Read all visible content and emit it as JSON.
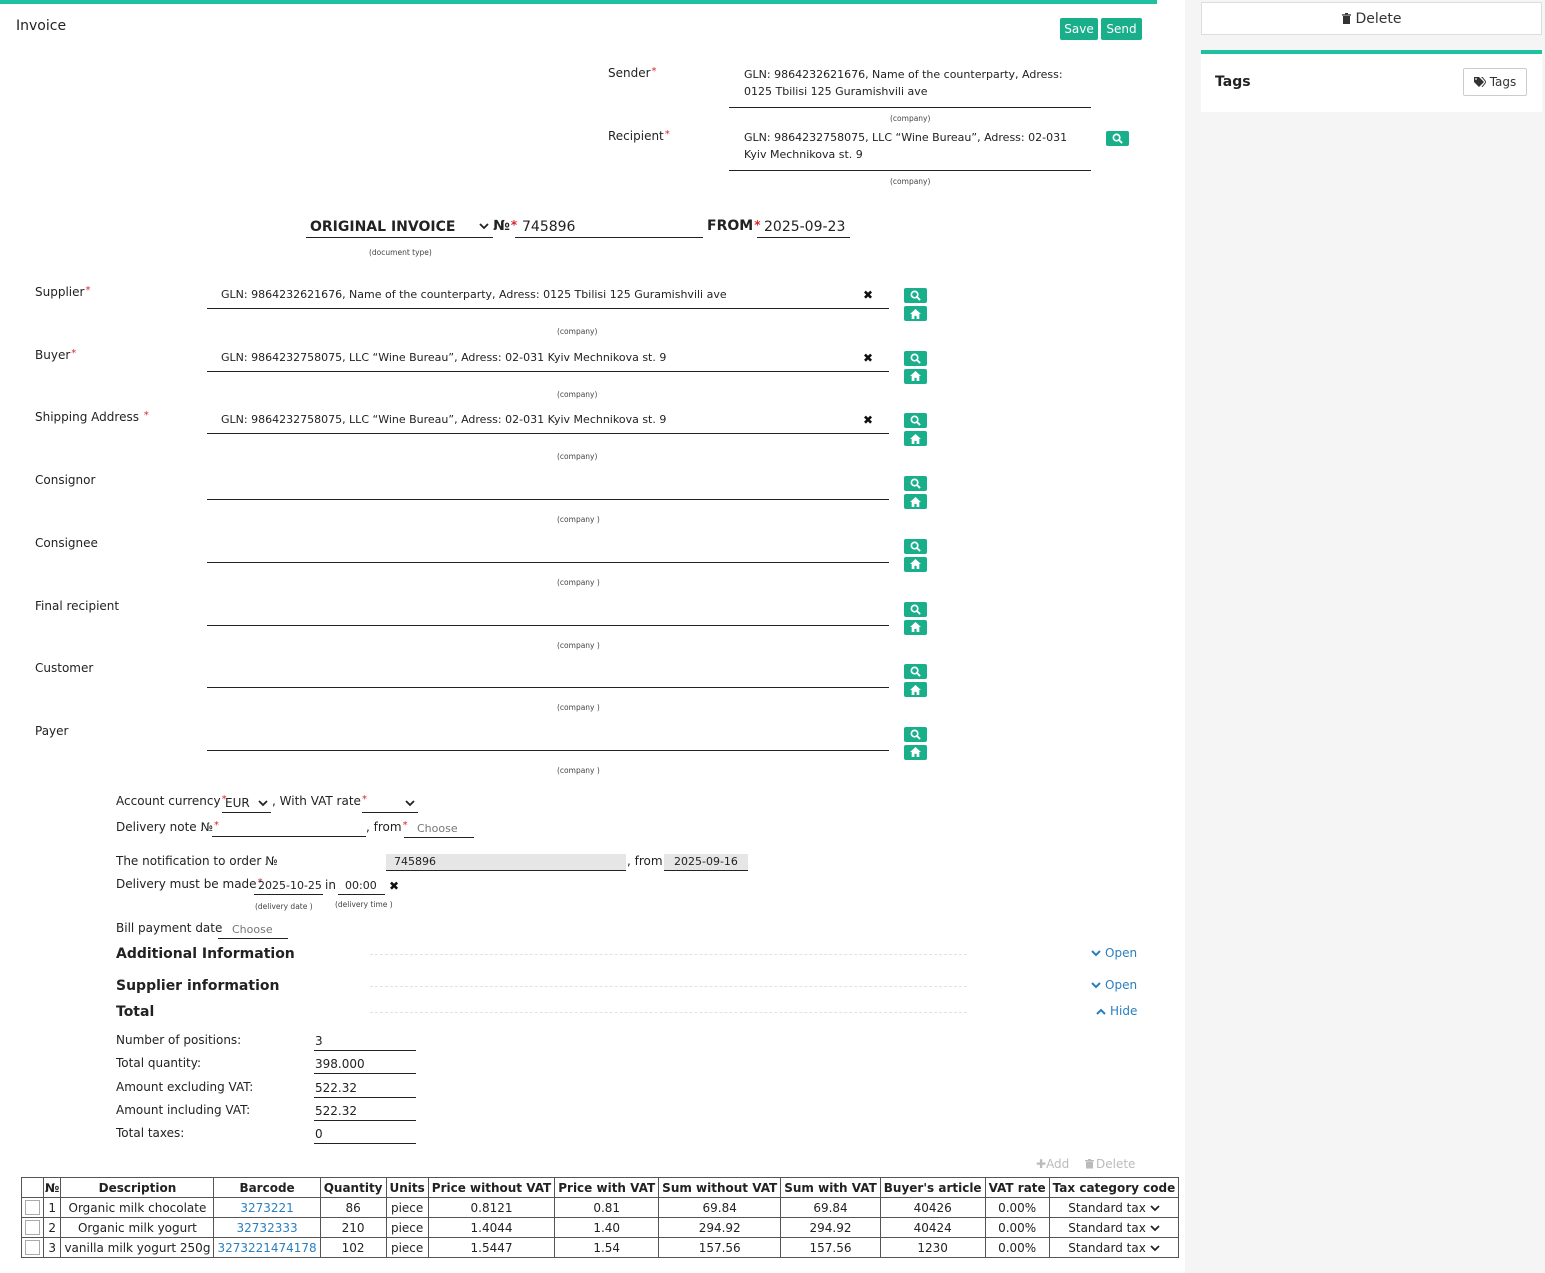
{
  "header": {
    "title": "Invoice",
    "save_label": "Save",
    "send_label": "Send"
  },
  "sender": {
    "label": "Sender",
    "line1": "GLN: 9864232621676, Name of the counterparty, Adress:",
    "line2": "0125 Tbilisi 125 Guramishvili ave",
    "hint": "(company)"
  },
  "recipient": {
    "label": "Recipient",
    "line1": "GLN: 9864232758075, LLC “Wine Bureau”, Adress: 02-031",
    "line2": "Kyiv Mechnikova st. 9",
    "hint": "(company)"
  },
  "document": {
    "type_value": "ORIGINAL INVOICE",
    "type_hint": "(document type)",
    "number_label": "№",
    "number_value": "745896",
    "from_label": "FROM",
    "from_value": "2025-09-23"
  },
  "parties": [
    {
      "label": "Supplier",
      "required": true,
      "value": "GLN: 9864232621676, Name of the counterparty, Adress: 0125 Tbilisi 125 Guramishvili ave",
      "hint": "(company)"
    },
    {
      "label": "Buyer",
      "required": true,
      "value": "GLN: 9864232758075, LLC “Wine Bureau”, Adress: 02-031 Kyiv Mechnikova st. 9",
      "hint": "(company)"
    },
    {
      "label": "Shipping Address ",
      "required": true,
      "value": "GLN: 9864232758075, LLC “Wine Bureau”, Adress: 02-031 Kyiv Mechnikova st. 9",
      "hint": "(company)"
    },
    {
      "label": "Consignor",
      "required": false,
      "value": "",
      "hint": "(company )"
    },
    {
      "label": "Consignee",
      "required": false,
      "value": "",
      "hint": "(company )"
    },
    {
      "label": "Final recipient",
      "required": false,
      "value": "",
      "hint": "(company )"
    },
    {
      "label": "Customer",
      "required": false,
      "value": "",
      "hint": "(company )"
    },
    {
      "label": "Payer",
      "required": false,
      "value": "",
      "hint": "(company )"
    }
  ],
  "details": {
    "currency_label": "Account currency",
    "currency_value": "EUR",
    "vat_label": ", With VAT rate",
    "delivery_note_label": "Delivery note №",
    "delivery_note_from": ", from",
    "choose_placeholder": "Choose",
    "order_label": "The notification to order №",
    "order_value": "745896",
    "order_from": ", from",
    "order_date": "2025-09-16",
    "delivery_label": "Delivery must be made",
    "delivery_date": "2025-10-25",
    "delivery_in": "in",
    "delivery_time": "00:00",
    "delivery_date_hint": "(delivery date )",
    "delivery_time_hint": "(delivery time )",
    "bill_label": "Bill payment date",
    "bill_placeholder": "Choose"
  },
  "sections": {
    "additional": "Additional Information",
    "supplier_info": "Supplier information",
    "total": "Total",
    "open_label": "Open",
    "hide_label": "Hide"
  },
  "totals": [
    {
      "label": "Number of positions:",
      "value": "3"
    },
    {
      "label": "Total quantity:",
      "value": "398.000"
    },
    {
      "label": "Amount excluding VAT:",
      "value": "522.32"
    },
    {
      "label": "Amount including VAT:",
      "value": "522.32"
    },
    {
      "label": "Total taxes:",
      "value": "0"
    }
  ],
  "table_actions": {
    "add": "Add",
    "delete": "Delete"
  },
  "table": {
    "headers": [
      "№",
      "Description",
      "Barcode",
      "Quantity",
      "Units",
      "Price without VAT",
      "Price with VAT",
      "Sum without VAT",
      "Sum with VAT",
      "Buyer's article",
      "VAT rate",
      "Tax category code"
    ],
    "rows": [
      [
        "1",
        "Organic milk chocolate",
        "3273221",
        "86",
        "piece",
        "0.8121",
        "0.81",
        "69.84",
        "69.84",
        "40426",
        "0.00%",
        "Standard tax"
      ],
      [
        "2",
        "Organic milk yogurt",
        "32732333",
        "210",
        "piece",
        "1.4044",
        "1.40",
        "294.92",
        "294.92",
        "40424",
        "0.00%",
        "Standard tax"
      ],
      [
        "3",
        "vanilla milk yogurt 250g",
        "3273221474178",
        "102",
        "piece",
        "1.5447",
        "1.54",
        "157.56",
        "157.56",
        "1230",
        "0.00%",
        "Standard tax"
      ]
    ]
  },
  "sidebar": {
    "delete_label": "Delete",
    "tags_title": "Tags",
    "tags_button": "Tags"
  },
  "colors": {
    "accent": "#1ec1a0",
    "button": "#1aaf8b",
    "link": "#2a7fbf",
    "required": "#d9232e"
  }
}
